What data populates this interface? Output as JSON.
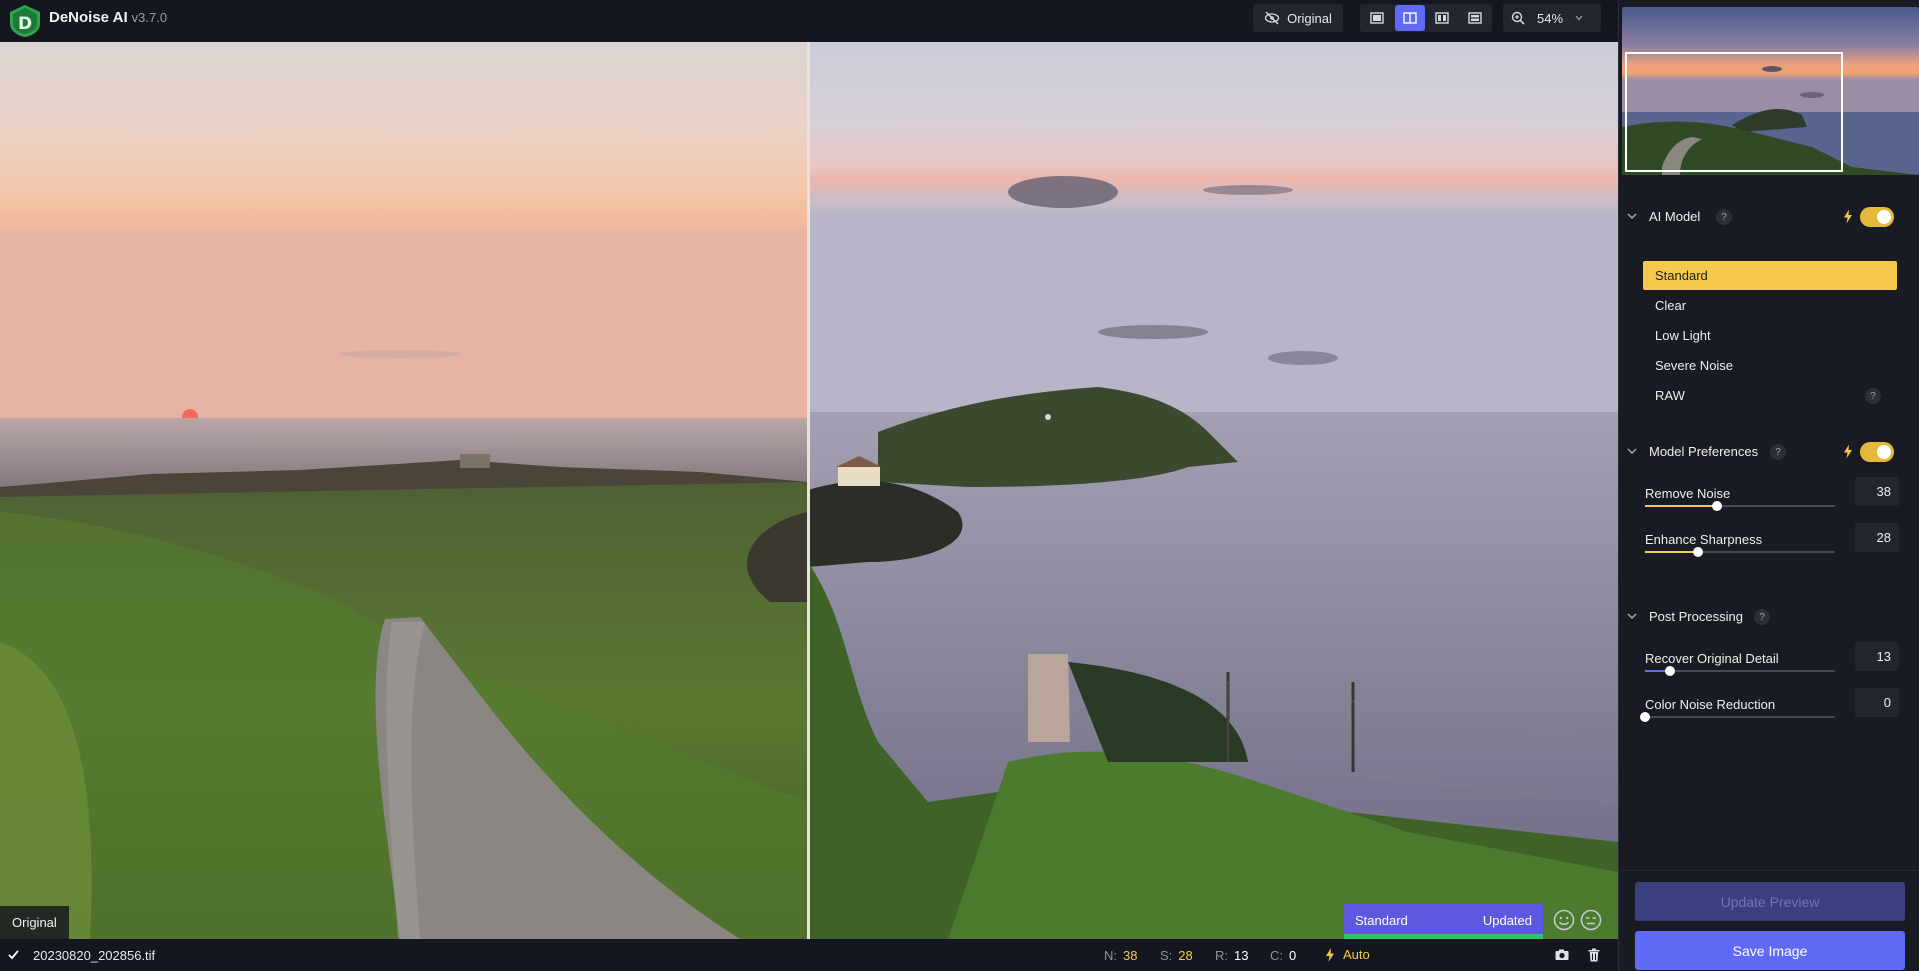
{
  "app": {
    "name": "DeNoise AI",
    "version": "v3.7.0"
  },
  "toolbar": {
    "original_button": "Original",
    "view_modes": [
      {
        "name": "single-view",
        "active": false
      },
      {
        "name": "split-view",
        "active": true
      },
      {
        "name": "side-by-side-view",
        "active": false
      },
      {
        "name": "comparison-view",
        "active": false
      }
    ],
    "zoom": "54%"
  },
  "preview": {
    "left_label": "Original",
    "model_status": {
      "model": "Standard",
      "state": "Updated"
    }
  },
  "statusbar": {
    "filename": "20230820_202856.tif",
    "stats": [
      {
        "key": "N:",
        "value": "38"
      },
      {
        "key": "S:",
        "value": "28"
      },
      {
        "key": "R:",
        "value": "13"
      },
      {
        "key": "C:",
        "value": "0"
      }
    ],
    "mode": "Auto"
  },
  "panel": {
    "ai_model": {
      "title": "AI Model",
      "help": "?",
      "enabled": true,
      "models": [
        "Standard",
        "Clear",
        "Low Light",
        "Severe Noise",
        "RAW"
      ],
      "selected": "Standard",
      "raw_help": "?"
    },
    "model_preferences": {
      "title": "Model Preferences",
      "help": "?",
      "enabled": true,
      "sliders": [
        {
          "label": "Remove Noise",
          "value": "38",
          "fraction": 0.38
        },
        {
          "label": "Enhance Sharpness",
          "value": "28",
          "fraction": 0.28
        }
      ]
    },
    "post_processing": {
      "title": "Post Processing",
      "help": "?",
      "sliders": [
        {
          "label": "Recover Original Detail",
          "value": "13",
          "fraction": 0.13
        },
        {
          "label": "Color Noise Reduction",
          "value": "0",
          "fraction": 0.0
        }
      ]
    },
    "update_button": "Update Preview",
    "save_button": "Save Image"
  },
  "colors": {
    "accent": "#5f6bf6",
    "selection": "#f5c94b",
    "toggle_on": "#e5b93b",
    "slider_fill": "#f5c94b",
    "slider_fill_alt": "#5f6bf6",
    "status_green": "#29c56a"
  }
}
